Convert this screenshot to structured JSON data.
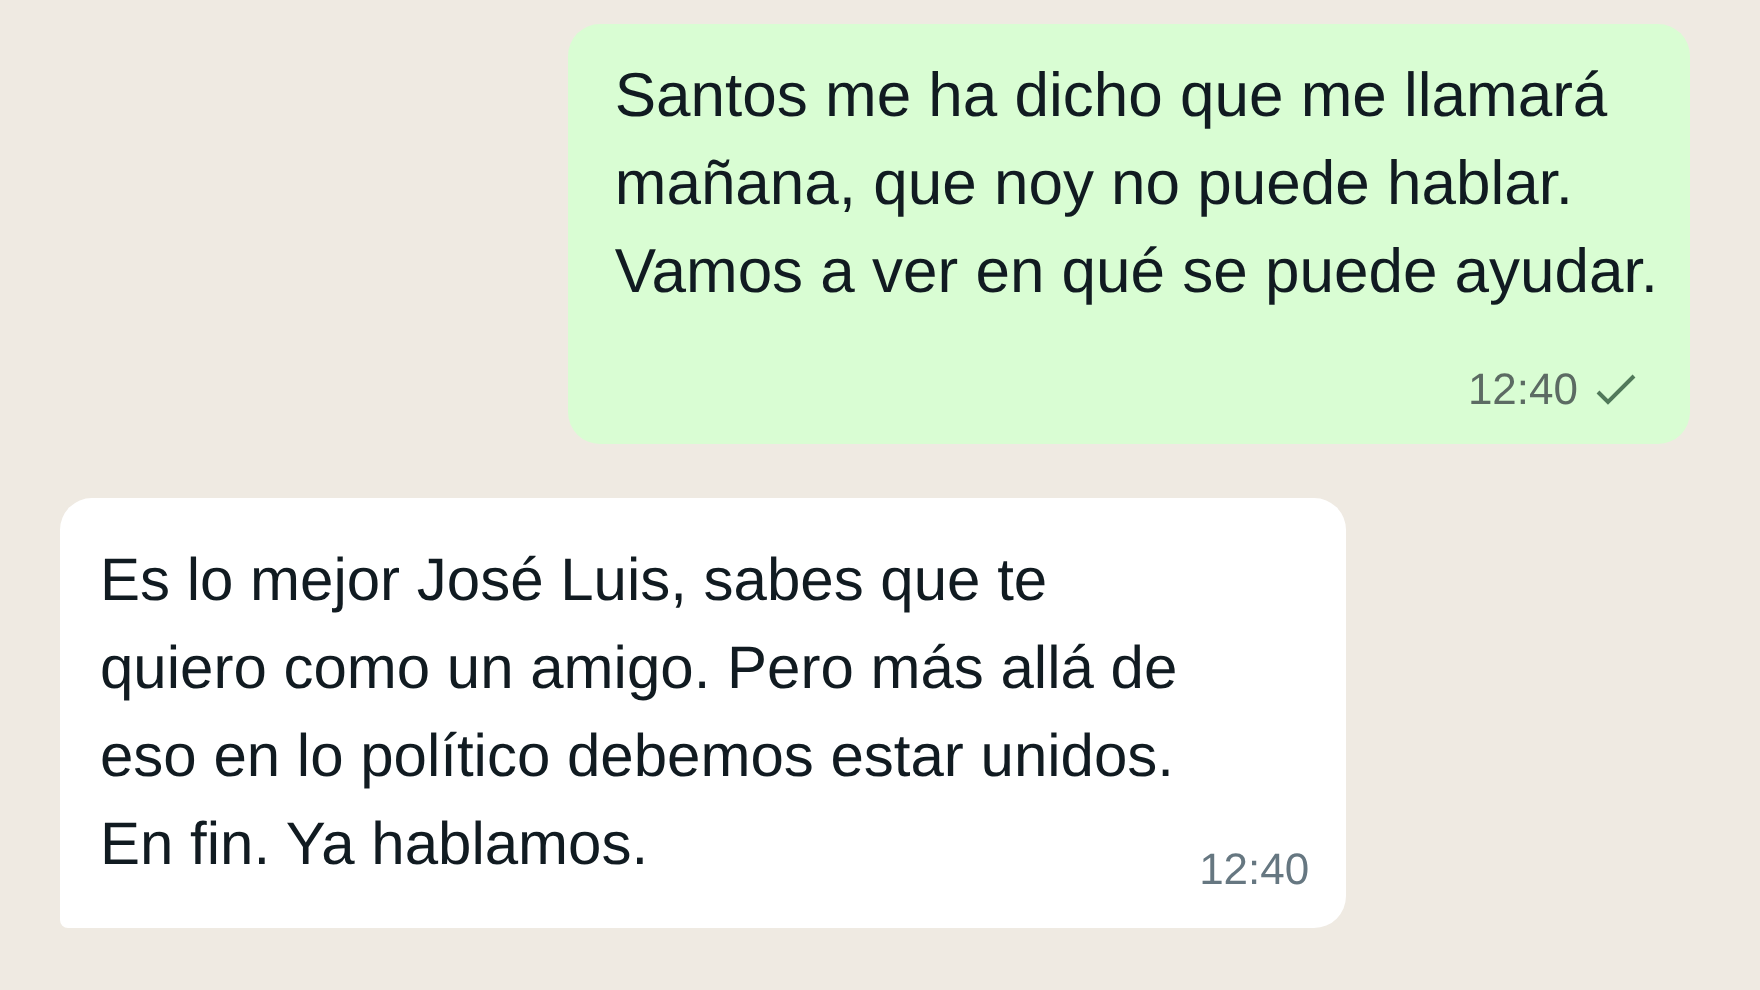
{
  "messages": [
    {
      "kind": "outgoing",
      "text": "Santos me ha dicho que me llamará\nmañana, que noy no puede hablar.\nVamos a ver en qué se puede ayudar.",
      "time": "12:40",
      "sent": true
    },
    {
      "kind": "incoming",
      "text": "Es lo mejor José Luis, sabes que te\nquiero como un amigo. Pero más allá de\neso en lo político debemos estar unidos.\nEn fin. Ya hablamos.",
      "time": "12:40"
    }
  ]
}
